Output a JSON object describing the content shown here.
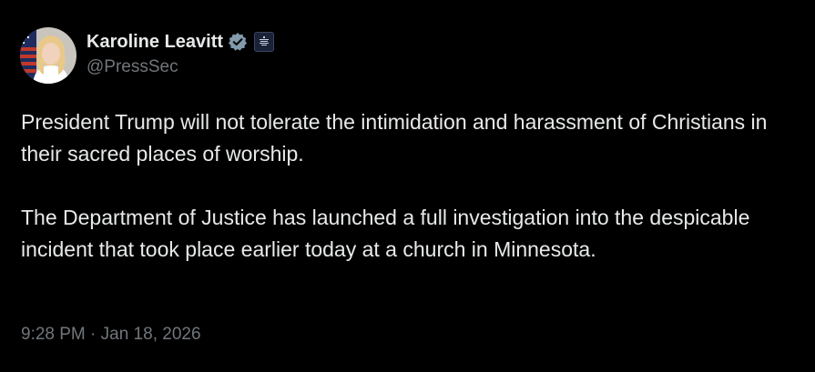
{
  "author": {
    "name": "Karoline Leavitt",
    "handle": "@PressSec",
    "avatar_icon": "profile-photo",
    "verified_icon": "verified-badge-icon",
    "affiliate_icon": "white-house-affiliate-icon",
    "verified_color": "#829aab"
  },
  "tweet": {
    "paragraphs": [
      "President Trump will not tolerate the intimidation and harassment of Christians in their sacred places of worship.",
      "The Department of Justice has launched a full investigation into the despicable incident that took place earlier today at a church in Minnesota."
    ],
    "timestamp": "9:28 PM · Jan 18, 2026"
  },
  "colors": {
    "background": "#000000",
    "text": "#e7e9ea",
    "secondary_text": "#71767b"
  }
}
